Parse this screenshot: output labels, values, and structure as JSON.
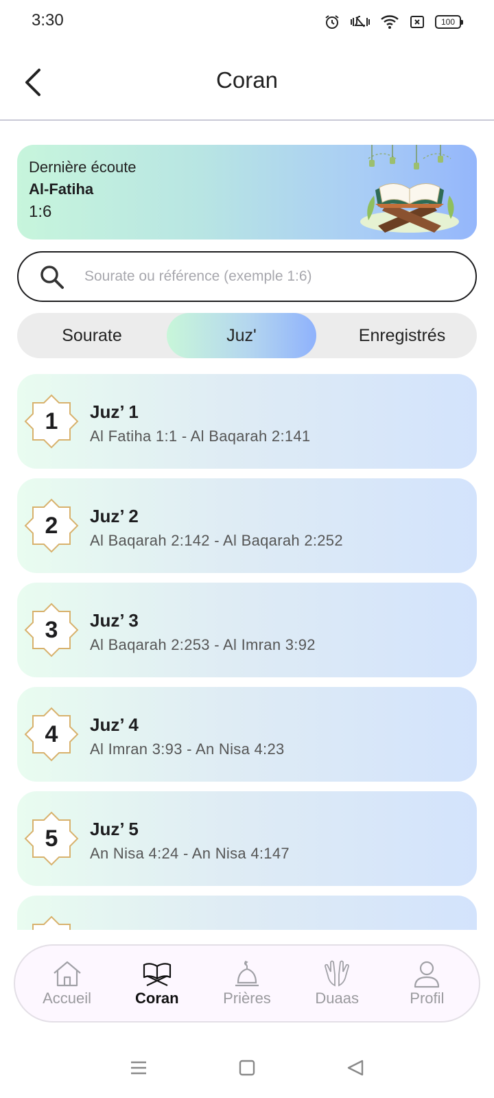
{
  "status_bar": {
    "time": "3:30",
    "battery": "100",
    "icons": [
      "alarm-icon",
      "vibrate-off-icon",
      "wifi-icon",
      "sim-x-icon",
      "battery-icon"
    ]
  },
  "header": {
    "title": "Coran",
    "back_icon": "chevron-left-icon"
  },
  "last_listened": {
    "label": "Dernière écoute",
    "surah": "Al-Fatiha",
    "reference": "1:6"
  },
  "search": {
    "placeholder": "Sourate ou référence (exemple 1:6)",
    "value": ""
  },
  "tabs": [
    {
      "label": "Sourate",
      "active": false
    },
    {
      "label": "Juz'",
      "active": true
    },
    {
      "label": "Enregistrés",
      "active": false
    }
  ],
  "juz": [
    {
      "number": "1",
      "name": "Juz’ 1",
      "range": "Al Fatiha 1:1 - Al Baqarah 2:141"
    },
    {
      "number": "2",
      "name": "Juz’ 2",
      "range": "Al Baqarah 2:142 - Al Baqarah 2:252"
    },
    {
      "number": "3",
      "name": "Juz’ 3",
      "range": "Al Baqarah 2:253 - Al Imran 3:92"
    },
    {
      "number": "4",
      "name": "Juz’ 4",
      "range": "Al Imran 3:93 - An Nisa 4:23"
    },
    {
      "number": "5",
      "name": "Juz’ 5",
      "range": "An Nisa 4:24 - An Nisa 4:147"
    },
    {
      "number": "",
      "name": "",
      "range": ""
    }
  ],
  "bottom_nav": [
    {
      "label": "Accueil",
      "icon": "home-icon",
      "active": false
    },
    {
      "label": "Coran",
      "icon": "quran-book-icon",
      "active": true
    },
    {
      "label": "Prières",
      "icon": "mosque-dome-icon",
      "active": false
    },
    {
      "label": "Duaas",
      "icon": "praying-hands-icon",
      "active": false
    },
    {
      "label": "Profil",
      "icon": "profile-icon",
      "active": false
    }
  ],
  "colors": {
    "accent_green": "#c7f5dc",
    "accent_blue": "#94b6fb",
    "text_dark": "#1d1d1f",
    "text_muted": "#9a9a9e"
  }
}
